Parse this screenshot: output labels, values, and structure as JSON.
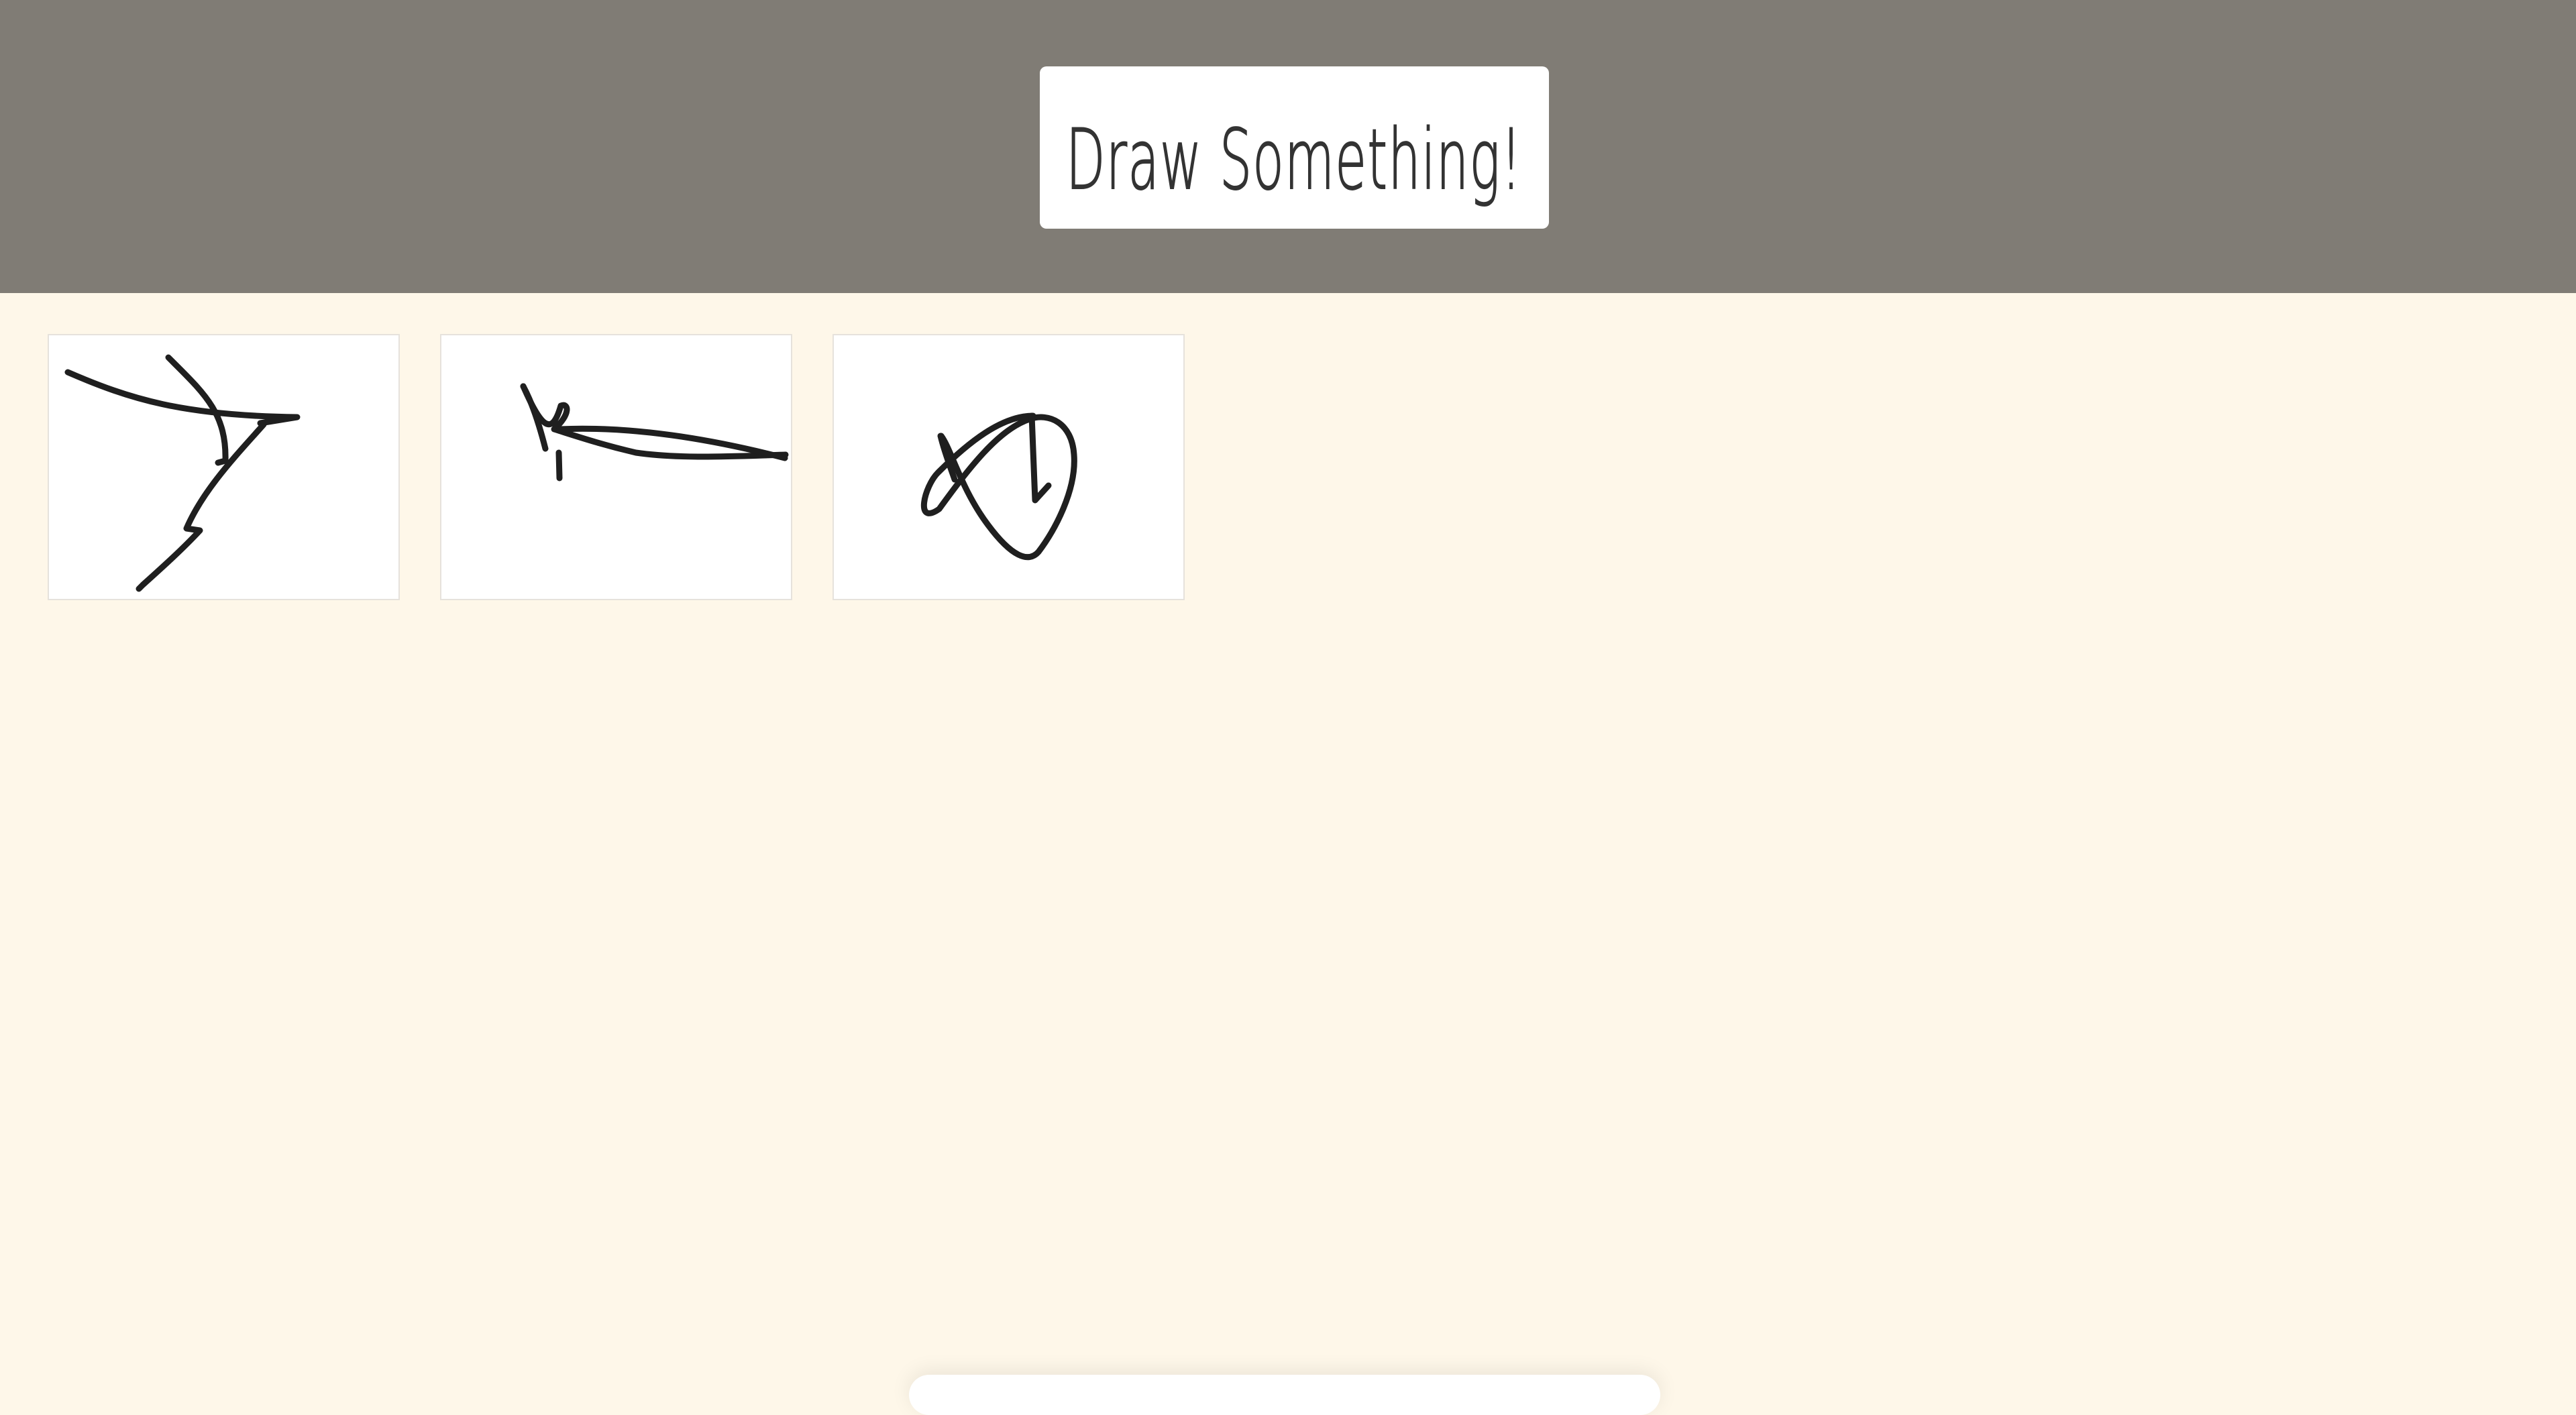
{
  "header": {
    "title": "Draw Something!"
  },
  "gallery": {
    "drawings": [
      {
        "label": ""
      },
      {
        "label": ""
      },
      {
        "label": ""
      }
    ]
  }
}
